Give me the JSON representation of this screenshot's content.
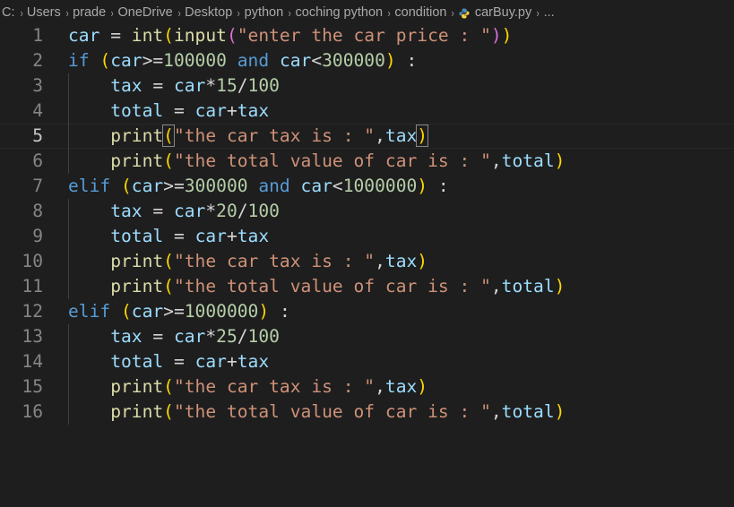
{
  "breadcrumb": {
    "items": [
      "C:",
      "Users",
      "prade",
      "OneDrive",
      "Desktop",
      "python",
      "coching python",
      "condition",
      "carBuy.py",
      "..."
    ],
    "separator": "›",
    "file_icon": "python-file-icon"
  },
  "editor": {
    "language": "python",
    "active_line": 5,
    "theme_colors": {
      "background": "#1e1e1e",
      "line_number": "#858585",
      "keyword": "#569cd6",
      "string": "#ce9178",
      "number": "#b5cea8",
      "function": "#dcdcaa",
      "variable": "#9cdcfe"
    },
    "lines": [
      {
        "n": "1",
        "text": "car = int(input(\"enter the car price : \"))"
      },
      {
        "n": "2",
        "text": "if (car>=100000 and car<300000) :"
      },
      {
        "n": "3",
        "text": "    tax = car*15/100"
      },
      {
        "n": "4",
        "text": "    total = car+tax"
      },
      {
        "n": "5",
        "text": "    print(\"the car tax is : \",tax)"
      },
      {
        "n": "6",
        "text": "    print(\"the total value of car is : \",total)"
      },
      {
        "n": "7",
        "text": "elif (car>=300000 and car<1000000) :"
      },
      {
        "n": "8",
        "text": "    tax = car*20/100"
      },
      {
        "n": "9",
        "text": "    total = car+tax"
      },
      {
        "n": "10",
        "text": "    print(\"the car tax is : \",tax)"
      },
      {
        "n": "11",
        "text": "    print(\"the total value of car is : \",total)"
      },
      {
        "n": "12",
        "text": "elif (car>=1000000) :"
      },
      {
        "n": "13",
        "text": "    tax = car*25/100"
      },
      {
        "n": "14",
        "text": "    total = car+tax"
      },
      {
        "n": "15",
        "text": "    print(\"the car tax is : \",tax)"
      },
      {
        "n": "16",
        "text": "    print(\"the total value of car is : \",total)"
      }
    ]
  }
}
